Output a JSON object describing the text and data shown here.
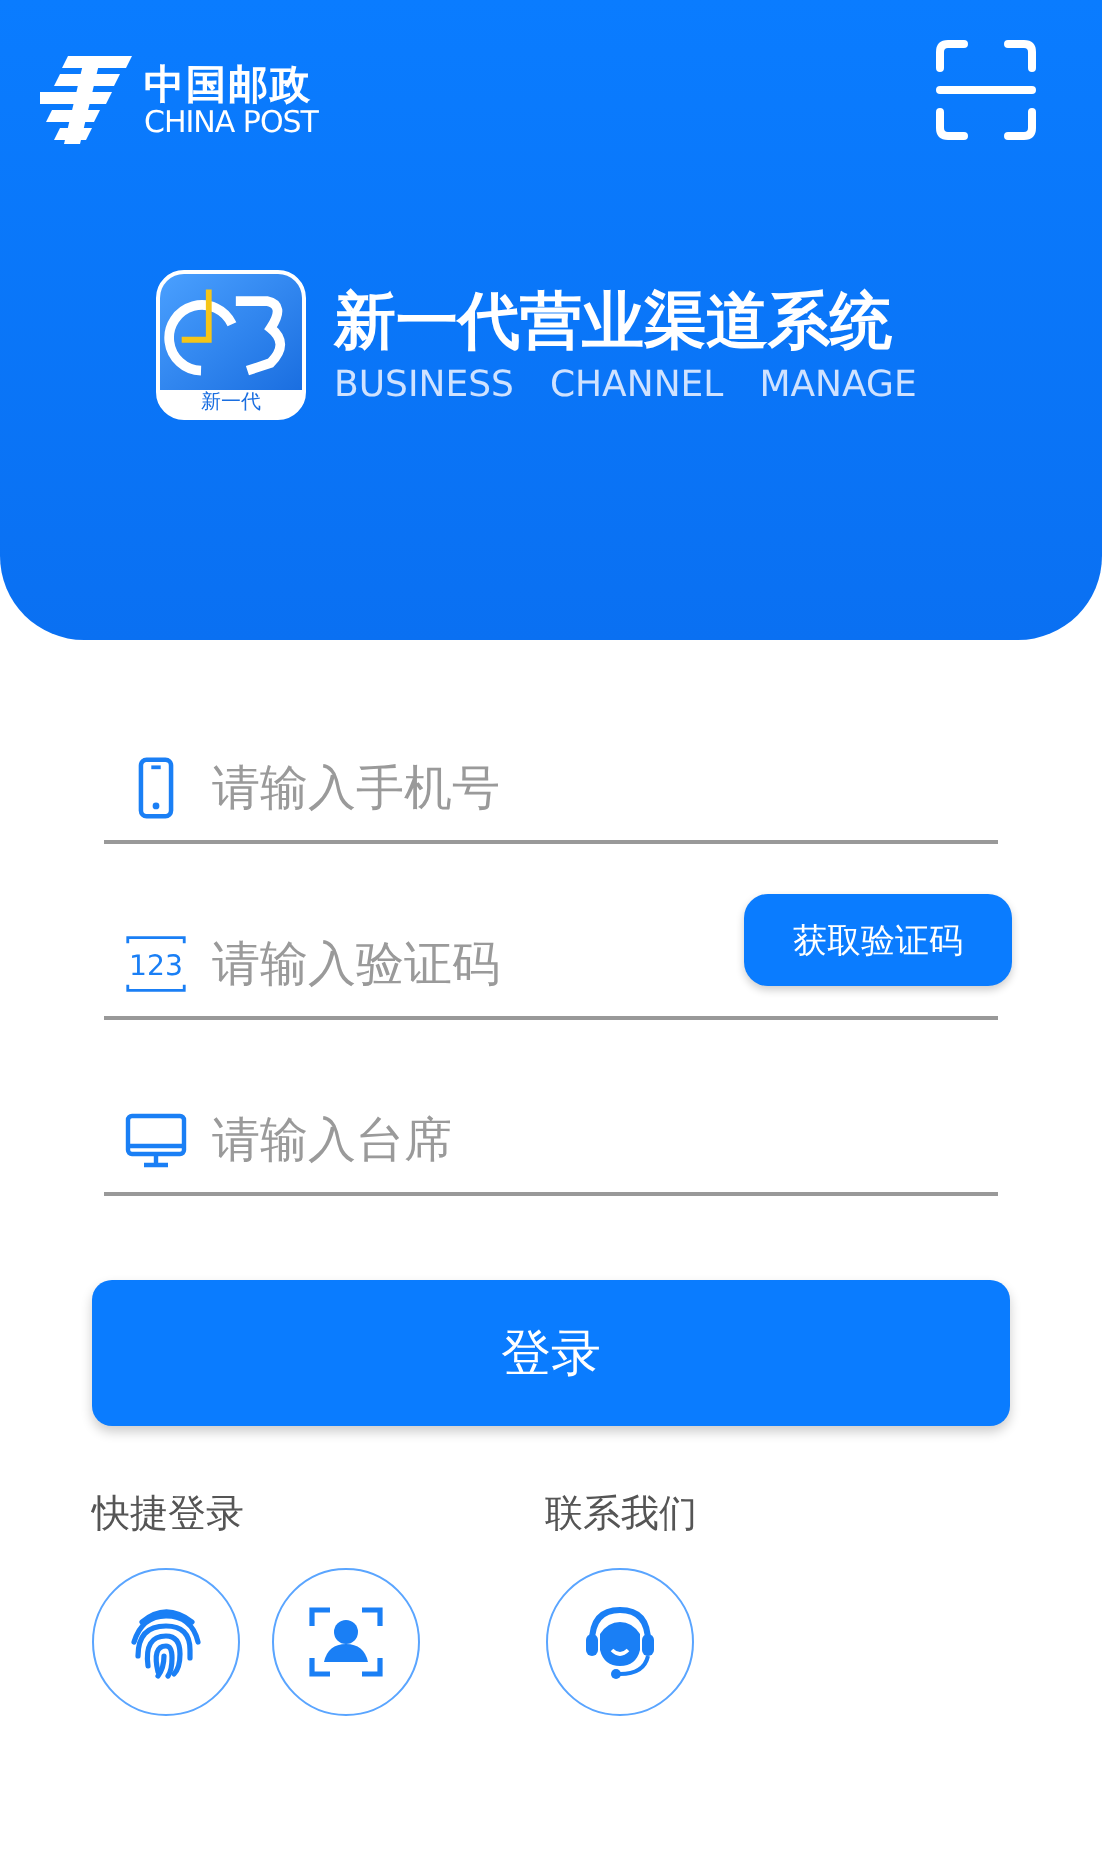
{
  "header": {
    "logo": {
      "name": "中国邮政",
      "name_en": "CHINA POST"
    },
    "app": {
      "icon_label": "新一代",
      "title": "新一代营业渠道系统",
      "subtitle": [
        "BUSINESS",
        "CHANNEL",
        "MANAGE"
      ]
    }
  },
  "fields": [
    {
      "kind": "phone",
      "placeholder": "请输入手机号"
    },
    {
      "kind": "code",
      "placeholder": "请输入验证码",
      "icon_text": "123",
      "action": "获取验证码"
    },
    {
      "kind": "desk",
      "placeholder": "请输入台席"
    }
  ],
  "login_button": "登录",
  "quick_login": {
    "label": "快捷登录",
    "items": [
      {
        "kind": "fingerprint"
      },
      {
        "kind": "face"
      }
    ]
  },
  "contact": {
    "label": "联系我们",
    "items": [
      {
        "kind": "headset"
      }
    ]
  }
}
